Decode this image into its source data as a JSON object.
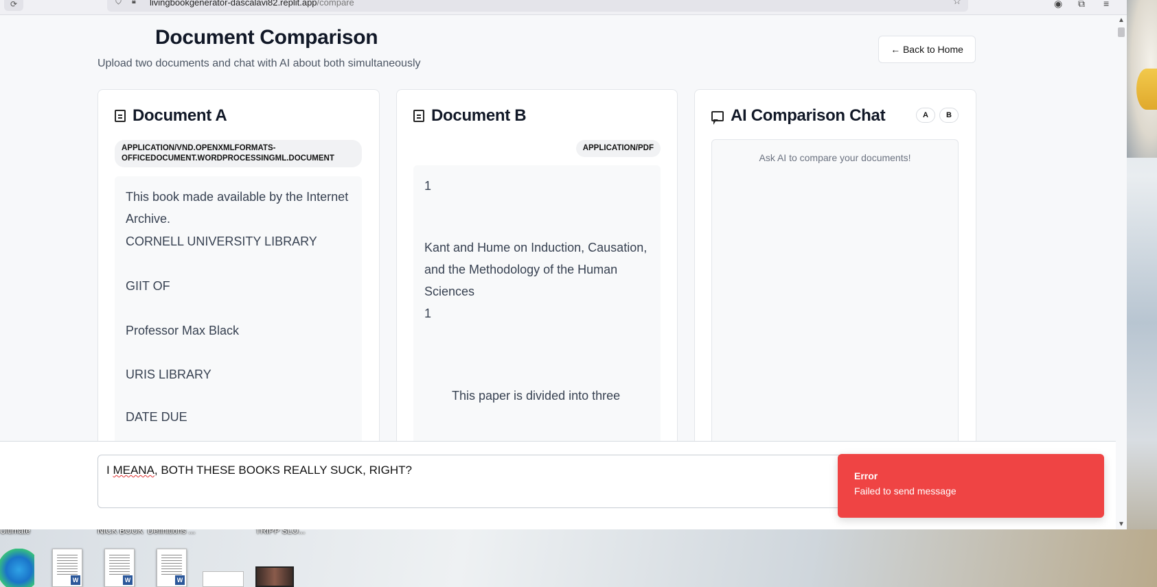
{
  "browser": {
    "url_host": "livingbookgenerator-dascalavi82.replit.app",
    "url_path": "/compare"
  },
  "header": {
    "title": "Document Comparison",
    "subtitle": "Upload two documents and chat with AI about both simultaneously",
    "back_button": "← Back to Home"
  },
  "doc_a": {
    "title": "Document A",
    "mime": "APPLICATION/VND.OPENXMLFORMATS-OFFICEDOCUMENT.WORDPROCESSINGML.DOCUMENT",
    "paragraphs": [
      "This book made available by the Internet Archive.",
      "CORNELL UNIVERSITY LIBRARY",
      "GIIT OF",
      "Professor Max Black",
      "URIS LIBRARY",
      "DATE DUE"
    ]
  },
  "doc_b": {
    "title": "Document B",
    "mime": "APPLICATION/PDF",
    "lines": {
      "page_num_1": "1",
      "title_1": "Kant and Hume on Induction, Causation,",
      "title_2": "and the Methodology of the Human Sciences",
      "page_num_2": "1",
      "body_1": "This paper is divided into three"
    }
  },
  "chat": {
    "title": "AI Comparison Chat",
    "chip_a": "A",
    "chip_b": "B",
    "empty_text": "Ask AI to compare your documents!"
  },
  "input": {
    "value_prefix": "I ",
    "value_typo": "MEANA",
    "value_rest": ", BOTH THESE BOOKS REALLY SUCK, RIGHT?"
  },
  "toast": {
    "title": "Error",
    "message": "Failed to send message",
    "color": "#ef4444"
  },
  "desktop": {
    "labels": [
      "Ultimate",
      "NICK BOOK",
      "Definitions ...",
      "TRIPP SLO..."
    ]
  }
}
